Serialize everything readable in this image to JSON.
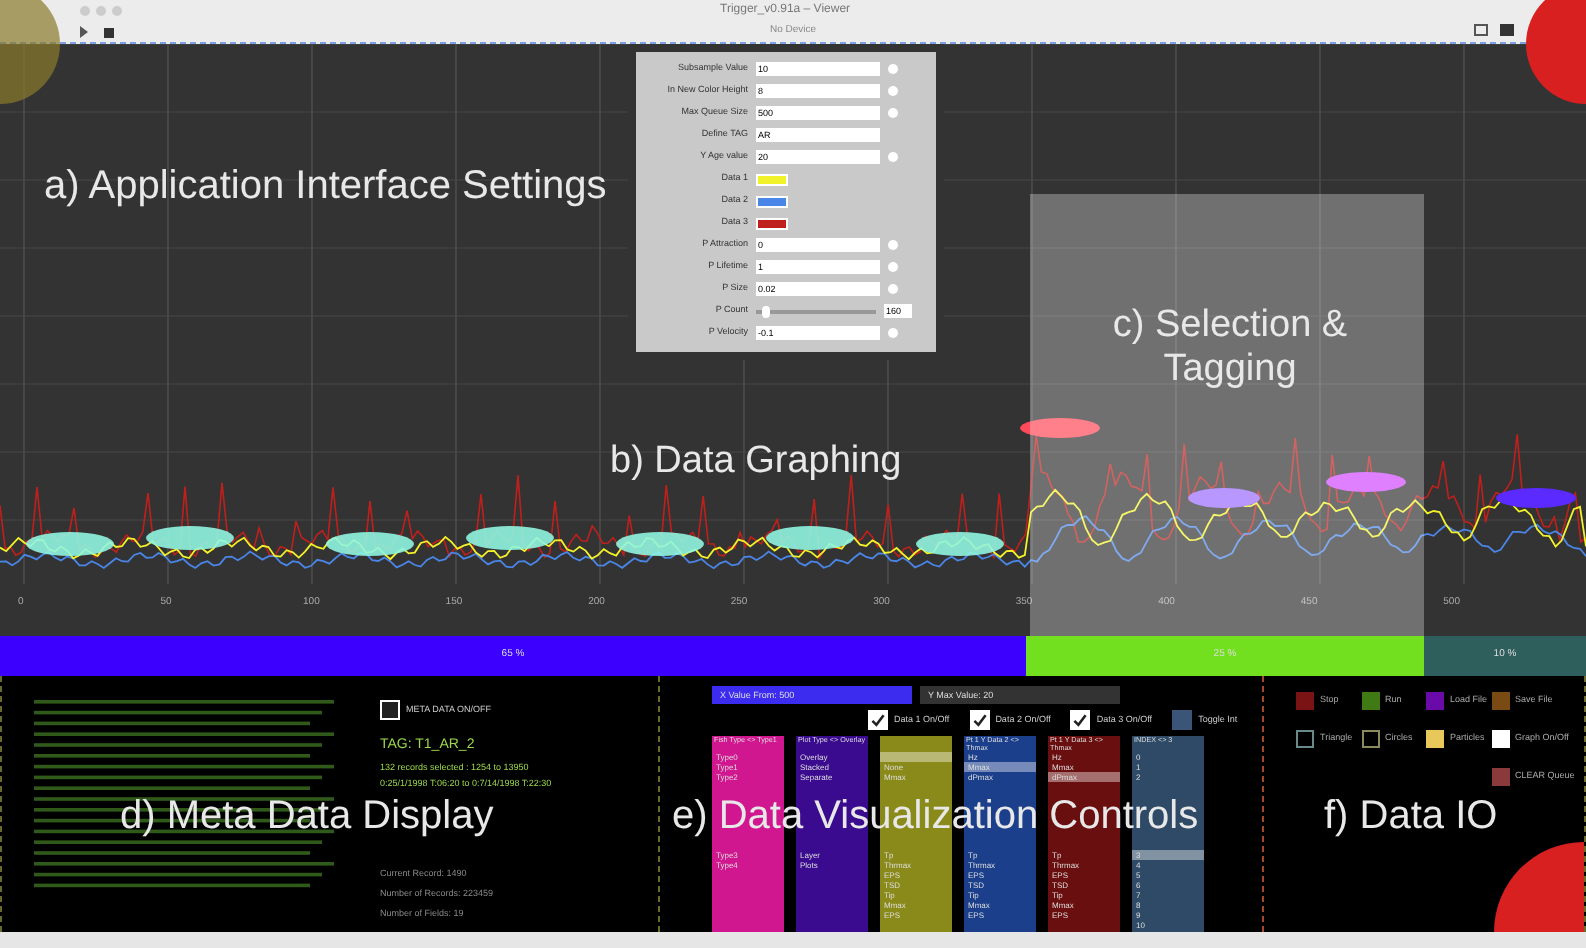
{
  "window": {
    "title": "Trigger_v0.91a – Viewer",
    "subtitle": "No Device"
  },
  "graph": {
    "x_ticks": [
      "0",
      "50",
      "100",
      "150",
      "200",
      "250",
      "300",
      "350",
      "400",
      "450",
      "500"
    ]
  },
  "annotations": [
    {
      "kind": "a",
      "text": "a) Application Interface Settings"
    },
    {
      "kind": "b",
      "text": "b) Data Graphing"
    },
    {
      "kind": "c",
      "text": "c) Selection & Tagging"
    },
    {
      "kind": "d",
      "text": "d) Meta Data Display"
    },
    {
      "kind": "e",
      "text": "e) Data Visualization Controls"
    },
    {
      "kind": "f",
      "text": "f) Data IO"
    }
  ],
  "settings": [
    {
      "kind": "spin",
      "label": "Subsample Value",
      "value": "10"
    },
    {
      "kind": "spin",
      "label": "In New Color Height",
      "value": "8"
    },
    {
      "kind": "spin",
      "label": "Max Queue Size",
      "value": "500"
    },
    {
      "kind": "text",
      "label": "Define TAG",
      "value": "AR"
    },
    {
      "kind": "spin",
      "label": "Y Age value",
      "value": "20"
    },
    {
      "kind": "color",
      "label": "Data 1",
      "color": "#f2f22a"
    },
    {
      "kind": "color",
      "label": "Data 2",
      "color": "#4a86e8"
    },
    {
      "kind": "color",
      "label": "Data 3",
      "color": "#c0201c"
    },
    {
      "kind": "spin",
      "label": "P Attraction",
      "value": "0"
    },
    {
      "kind": "spin",
      "label": "P Lifetime",
      "value": "1"
    },
    {
      "kind": "spin",
      "label": "P Size",
      "value": "0.02"
    },
    {
      "kind": "slider",
      "label": "P Count",
      "value": "160",
      "level": 0.05
    },
    {
      "kind": "spin",
      "label": "P Velocity",
      "value": "-0.1"
    }
  ],
  "progress": [
    {
      "label": "65 %",
      "color": "#3c00ff"
    },
    {
      "label": "25 %",
      "color": "#72e01e"
    },
    {
      "label": "10 %",
      "color": "#2f5f5c"
    }
  ],
  "meta": {
    "toggle": {
      "label": "META DATA ON/OFF",
      "checked": false
    },
    "tag": "TAG: T1_AR_2",
    "selected": "132 records selected : 1254 to 13950",
    "range": "0:25/1/1998 T:06:20 to 0:7/14/1998 T:22:30",
    "stats": [
      "Current Record: 1490",
      "Number of Records: 223459",
      "Number of Fields: 19"
    ]
  },
  "viz": {
    "fields": [
      "X Value From: 500",
      "Y Max Value: 20"
    ],
    "toggles": [
      {
        "label": "Data 1 On/Off",
        "checked": true
      },
      {
        "label": "Data 2 On/Off",
        "checked": true
      },
      {
        "label": "Data 3 On/Off",
        "checked": true
      },
      {
        "label": "Toggle Int",
        "checked": false
      }
    ],
    "columns": [
      {
        "header": "Fish Type <> Type1",
        "color": "#d0178f",
        "items": [
          {
            "label": "Type0",
            "selected": false
          },
          {
            "label": "Type1",
            "selected": false
          },
          {
            "label": "Type2",
            "selected": false
          },
          {
            "label": "Type3",
            "selected": false
          },
          {
            "label": "Type4",
            "selected": false
          }
        ]
      },
      {
        "header": "Plot Type <> Overlay",
        "color": "#3a0b8f",
        "items": [
          {
            "label": "Overlay",
            "selected": false
          },
          {
            "label": "Stacked",
            "selected": false
          },
          {
            "label": "Separate",
            "selected": false
          },
          {
            "label": "Layer",
            "selected": false
          },
          {
            "label": "Plots",
            "selected": false
          }
        ]
      },
      {
        "color": "#8a8a1a",
        "items": [
          {
            "selected": true
          },
          {
            "label": "None",
            "selected": false
          },
          {
            "label": "Mmax",
            "selected": false
          },
          {
            "label": "Tp",
            "selected": false
          },
          {
            "label": "Thrmax",
            "selected": false
          },
          {
            "label": "EPS",
            "selected": false
          },
          {
            "label": "TSD",
            "selected": false
          },
          {
            "label": "Tip",
            "selected": false
          },
          {
            "label": "Mmax",
            "selected": false
          },
          {
            "label": "EPS",
            "selected": false
          }
        ]
      },
      {
        "header": "Pt 1 Y Data 2 <> Thmax",
        "color": "#1c3f8c",
        "items": [
          {
            "label": "Hz",
            "selected": false
          },
          {
            "label": "Mmax",
            "selected": true
          },
          {
            "label": "dPmax",
            "selected": false
          },
          {
            "label": "Tp",
            "selected": false
          },
          {
            "label": "Thrmax",
            "selected": false
          },
          {
            "label": "EPS",
            "selected": false
          },
          {
            "label": "TSD",
            "selected": false
          },
          {
            "label": "Tip",
            "selected": false
          },
          {
            "label": "Mmax",
            "selected": false
          },
          {
            "label": "EPS",
            "selected": false
          }
        ]
      },
      {
        "header": "Pt 1 Y Data 3 <> Thmax",
        "color": "#6a0f0f",
        "items": [
          {
            "label": "Hz",
            "selected": false
          },
          {
            "label": "Mmax",
            "selected": false
          },
          {
            "label": "dPmax",
            "selected": true
          },
          {
            "label": "Tp",
            "selected": false
          },
          {
            "label": "Thrmax",
            "selected": false
          },
          {
            "label": "EPS",
            "selected": false
          },
          {
            "label": "TSD",
            "selected": false
          },
          {
            "label": "Tip",
            "selected": false
          },
          {
            "label": "Mmax",
            "selected": false
          },
          {
            "label": "EPS",
            "selected": false
          }
        ]
      },
      {
        "header": "INDEX <> 3",
        "color": "#2e4a66",
        "items": [
          {
            "label": "0",
            "selected": false
          },
          {
            "label": "1",
            "selected": false
          },
          {
            "label": "2",
            "selected": false
          },
          {
            "label": "3",
            "selected": true
          },
          {
            "label": "4",
            "selected": false
          },
          {
            "label": "5",
            "selected": false
          },
          {
            "label": "6",
            "selected": false
          },
          {
            "label": "7",
            "selected": false
          },
          {
            "label": "8",
            "selected": false
          },
          {
            "label": "9",
            "selected": false
          },
          {
            "label": "10",
            "selected": false
          }
        ]
      }
    ]
  },
  "io": {
    "buttons": [
      {
        "label": "Stop",
        "color": "#7a1414",
        "filled": true
      },
      {
        "label": "Run",
        "color": "#3f7a14",
        "filled": true
      },
      {
        "label": "Load File",
        "color": "#6a0aa8",
        "filled": true
      },
      {
        "label": "Save File",
        "color": "#7a4a14",
        "filled": true
      },
      {
        "label": "Triangle",
        "color": "#6a8a8a",
        "filled": false
      },
      {
        "label": "Circles",
        "color": "#8a8a5a",
        "filled": false
      },
      {
        "label": "Particles",
        "color": "#e8c85a",
        "filled": true
      },
      {
        "label": "Graph On/Off",
        "color": "#ffffff",
        "filled": true
      },
      {
        "label": "CLEAR Queue",
        "color": "#8a3a3a",
        "filled": true
      }
    ]
  }
}
